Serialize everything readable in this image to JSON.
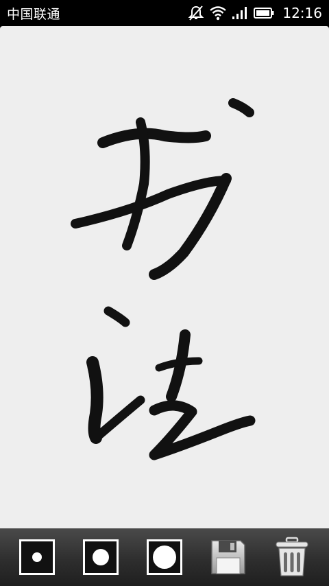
{
  "status_bar": {
    "carrier": "中国联通",
    "time": "12:16",
    "icons": [
      "mute-icon",
      "wifi-icon",
      "signal-icon",
      "battery-icon"
    ]
  },
  "canvas": {
    "background": "#eeeeee",
    "ink_color": "#111111",
    "drawing": "书法"
  },
  "toolbar": {
    "tools": [
      {
        "name": "brush-small-button",
        "icon": "brush-small-icon"
      },
      {
        "name": "brush-medium-button",
        "icon": "brush-medium-icon"
      },
      {
        "name": "brush-large-button",
        "icon": "brush-large-icon"
      },
      {
        "name": "save-button",
        "icon": "floppy-disk-icon"
      },
      {
        "name": "clear-button",
        "icon": "trash-can-icon"
      }
    ]
  }
}
